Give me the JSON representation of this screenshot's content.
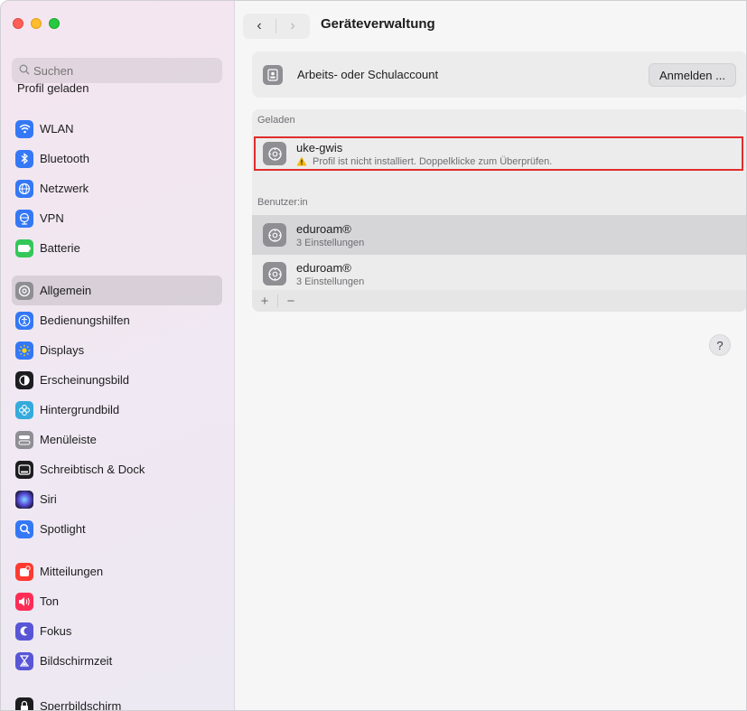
{
  "window": {
    "title": "Geräteverwaltung"
  },
  "sidebar": {
    "search_placeholder": "Suchen",
    "ghost_label": "Profil geladen",
    "groups": [
      [
        {
          "label": "WLAN",
          "icon": "wifi-icon",
          "color": "#3478f6"
        },
        {
          "label": "Bluetooth",
          "icon": "bluetooth-icon",
          "color": "#3478f6"
        },
        {
          "label": "Netzwerk",
          "icon": "globe-icon",
          "color": "#3478f6"
        },
        {
          "label": "VPN",
          "icon": "vpn-globe-icon",
          "color": "#3478f6"
        },
        {
          "label": "Batterie",
          "icon": "battery-icon",
          "color": "#34c759"
        }
      ],
      [
        {
          "label": "Allgemein",
          "icon": "gear-icon",
          "color": "#8e8e93",
          "active": true
        },
        {
          "label": "Bedienungshilfen",
          "icon": "accessibility-icon",
          "color": "#3478f6"
        },
        {
          "label": "Displays",
          "icon": "sun-icon",
          "color": "#3478f6"
        },
        {
          "label": "Erscheinungsbild",
          "icon": "appearance-icon",
          "color": "#1d1d1f"
        },
        {
          "label": "Hintergrundbild",
          "icon": "flower-icon",
          "color": "#35aadc"
        },
        {
          "label": "Menüleiste",
          "icon": "menubar-icon",
          "color": "#8e8e93"
        },
        {
          "label": "Schreibtisch & Dock",
          "icon": "dock-icon",
          "color": "#1d1d1f"
        },
        {
          "label": "Siri",
          "icon": "siri-icon",
          "color": "#2c2c54"
        },
        {
          "label": "Spotlight",
          "icon": "magnifier-icon",
          "color": "#3478f6"
        }
      ],
      [
        {
          "label": "Mitteilungen",
          "icon": "bell-icon",
          "color": "#ff3b30"
        },
        {
          "label": "Ton",
          "icon": "speaker-icon",
          "color": "#ff2d55"
        },
        {
          "label": "Fokus",
          "icon": "moon-icon",
          "color": "#5856d6"
        },
        {
          "label": "Bildschirmzeit",
          "icon": "hourglass-icon",
          "color": "#5856d6"
        }
      ],
      [
        {
          "label": "Sperrbildschirm",
          "icon": "lock-icon",
          "color": "#1d1d1f"
        }
      ]
    ]
  },
  "toolbar": {
    "back": "‹",
    "forward": "›"
  },
  "account": {
    "label": "Arbeits- oder Schulaccount",
    "button": "Anmelden ..."
  },
  "sections": {
    "loaded": "Geladen",
    "user": "Benutzer:in"
  },
  "profiles": {
    "loaded": {
      "name": "uke-gwis",
      "warning": "Profil ist nicht installiert. Doppelklicke zum Überprüfen."
    },
    "user": [
      {
        "name": "eduroam®",
        "sub": "3 Einstellungen"
      },
      {
        "name": "eduroam®",
        "sub": "3 Einstellungen"
      }
    ]
  },
  "controls": {
    "add": "+",
    "remove": "−",
    "help": "?"
  },
  "colors": {
    "highlight": "#e02d2d",
    "warning": "#f5b800"
  }
}
